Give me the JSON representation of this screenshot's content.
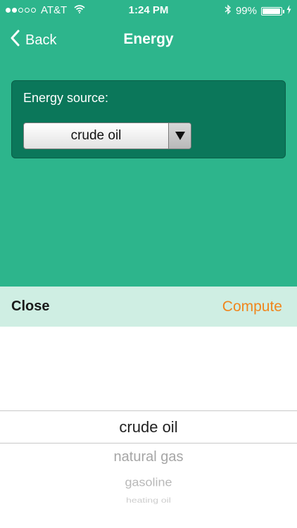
{
  "status_bar": {
    "signal_dots_filled": 2,
    "signal_dots_total": 5,
    "carrier": "AT&T",
    "time": "1:24 PM",
    "battery_percent": "99%",
    "battery_level": 0.99,
    "icons": [
      "wifi-icon",
      "bluetooth-icon",
      "battery-icon",
      "charging-bolt-icon"
    ]
  },
  "nav": {
    "back_label": "Back",
    "title": "Energy"
  },
  "energy_card": {
    "label": "Energy source:",
    "selected_value": "crude oil"
  },
  "toolbar": {
    "close_label": "Close",
    "compute_label": "Compute"
  },
  "picker": {
    "options": [
      "crude oil",
      "natural gas",
      "gasoline",
      "heating oil"
    ],
    "selected_index": 0
  },
  "colors": {
    "app_background": "#2db58c",
    "card_background": "#0b775a",
    "toolbar_background": "#cfeee3",
    "compute_accent": "#f0861d"
  }
}
